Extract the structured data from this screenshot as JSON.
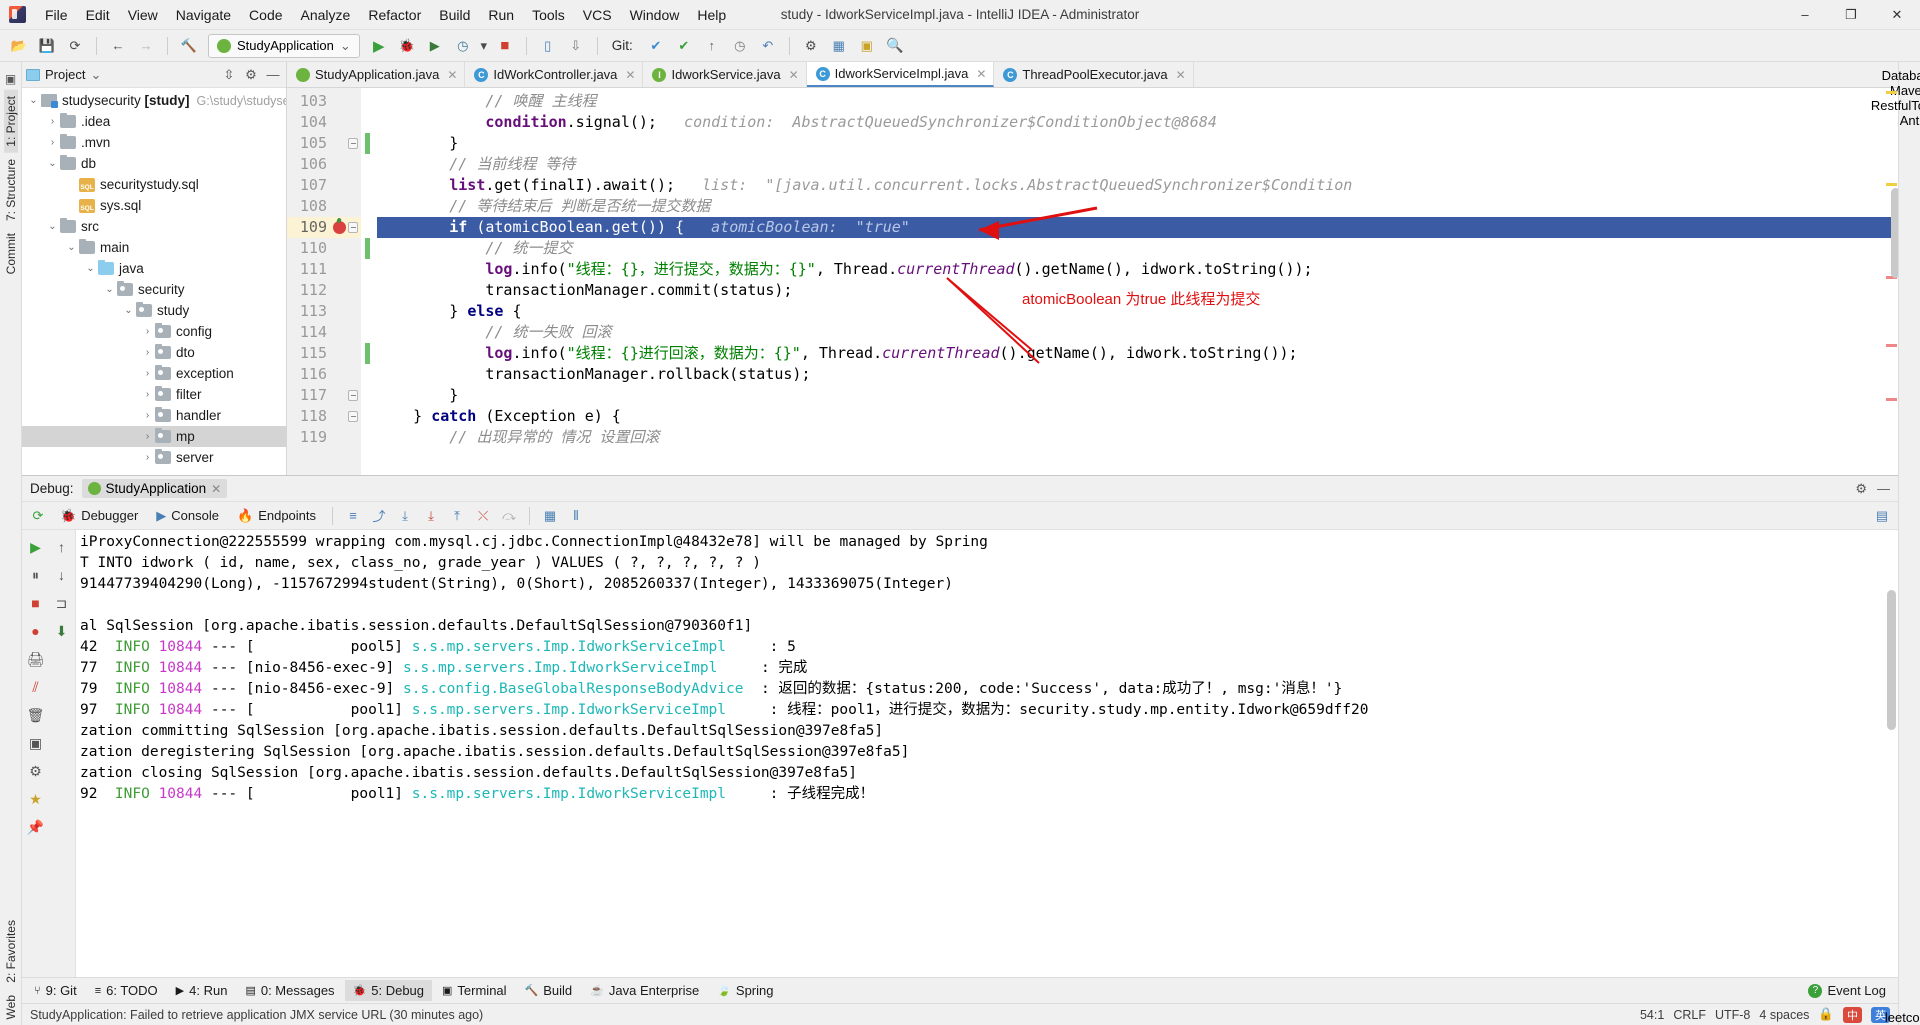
{
  "window": {
    "title": "study - IdworkServiceImpl.java - IntelliJ IDEA - Administrator",
    "minimize": "‒",
    "maximize": "❐",
    "close": "✕"
  },
  "menu": [
    {
      "label": "File"
    },
    {
      "label": "Edit"
    },
    {
      "label": "View"
    },
    {
      "label": "Navigate"
    },
    {
      "label": "Code"
    },
    {
      "label": "Analyze"
    },
    {
      "label": "Refactor"
    },
    {
      "label": "Build"
    },
    {
      "label": "Run"
    },
    {
      "label": "Tools"
    },
    {
      "label": "VCS"
    },
    {
      "label": "Window"
    },
    {
      "label": "Help"
    }
  ],
  "toolbar": {
    "open_icon": "📂",
    "save_icon": "💾",
    "sync_icon": "⟳",
    "back_icon": "←",
    "forward_icon": "→",
    "compile_icon": "🔨",
    "run_config": "StudyApplication",
    "run_config_caret": "⌄",
    "run_icon": "▶",
    "debug_icon": "🐞",
    "run_coverage_icon": "▶",
    "profile_icon": "◷",
    "profile_caret": "▾",
    "stop_icon": "■",
    "device_icon": "▯",
    "attach_icon": "⇩",
    "git_label": "Git:",
    "git_update_icon": "✔",
    "git_commit_icon": "✔",
    "git_push_icon": "↑",
    "git_history_icon": "◷",
    "undo_icon": "↶",
    "settings_icon": "⚙",
    "structure_icon": "▦",
    "bookmark_icon": "▣",
    "search_icon": "🔍"
  },
  "left_strip": {
    "project_label": "1: Project",
    "structure_label": "7: Structure",
    "commit_label": "Commit",
    "favorites_label": "2: Favorites",
    "web_label": "Web"
  },
  "right_strip": {
    "database_label": "Database",
    "maven_label": "Maven",
    "ant_label": "Ant",
    "restful_label": "RestfulToolkit",
    "leetcode_label": "leetcode"
  },
  "project_panel": {
    "title": "Project",
    "caret": "⌄",
    "collapse_icon": "⇳",
    "gear_icon": "⚙",
    "hide_icon": "—",
    "tree": [
      {
        "indent": 0,
        "twist": "⌄",
        "icon": "modroot",
        "label": "studysecurity",
        "bold": "[study]",
        "path": "G:\\study\\studysecurity",
        "selected": false
      },
      {
        "indent": 1,
        "twist": "›",
        "icon": "folder",
        "label": ".idea",
        "selected": false
      },
      {
        "indent": 1,
        "twist": "›",
        "icon": "folder",
        "label": ".mvn",
        "selected": false
      },
      {
        "indent": 1,
        "twist": "⌄",
        "icon": "folder",
        "label": "db",
        "selected": false
      },
      {
        "indent": 2,
        "twist": "",
        "icon": "sql",
        "label": "securitystudy.sql",
        "selected": false
      },
      {
        "indent": 2,
        "twist": "",
        "icon": "sql",
        "label": "sys.sql",
        "selected": false
      },
      {
        "indent": 1,
        "twist": "⌄",
        "icon": "folder",
        "label": "src",
        "selected": false
      },
      {
        "indent": 2,
        "twist": "⌄",
        "icon": "folder",
        "label": "main",
        "selected": false
      },
      {
        "indent": 3,
        "twist": "⌄",
        "icon": "folder-blue",
        "label": "java",
        "selected": false
      },
      {
        "indent": 4,
        "twist": "⌄",
        "icon": "folder-pkg",
        "label": "security",
        "selected": false
      },
      {
        "indent": 5,
        "twist": "⌄",
        "icon": "folder-pkg",
        "label": "study",
        "selected": false
      },
      {
        "indent": 6,
        "twist": "›",
        "icon": "folder-pkg",
        "label": "config",
        "selected": false
      },
      {
        "indent": 6,
        "twist": "›",
        "icon": "folder-pkg",
        "label": "dto",
        "selected": false
      },
      {
        "indent": 6,
        "twist": "›",
        "icon": "folder-pkg",
        "label": "exception",
        "selected": false
      },
      {
        "indent": 6,
        "twist": "›",
        "icon": "folder-pkg",
        "label": "filter",
        "selected": false
      },
      {
        "indent": 6,
        "twist": "›",
        "icon": "folder-pkg",
        "label": "handler",
        "selected": false
      },
      {
        "indent": 6,
        "twist": "›",
        "icon": "folder-pkg",
        "label": "mp",
        "selected": true
      },
      {
        "indent": 6,
        "twist": "›",
        "icon": "folder-pkg",
        "label": "server",
        "selected": false
      }
    ]
  },
  "editor_tabs": [
    {
      "label": "StudyApplication.java",
      "icon": "spring",
      "icon_char": "",
      "active": false,
      "close": "✕"
    },
    {
      "label": "IdWorkController.java",
      "icon": "c",
      "icon_char": "C",
      "active": false,
      "close": "✕"
    },
    {
      "label": "IdworkService.java",
      "icon": "i",
      "icon_char": "I",
      "active": false,
      "close": "✕"
    },
    {
      "label": "IdworkServiceImpl.java",
      "icon": "c",
      "icon_char": "C",
      "active": true,
      "close": "✕"
    },
    {
      "label": "ThreadPoolExecutor.java",
      "icon": "c",
      "icon_char": "C",
      "active": false,
      "close": "✕"
    }
  ],
  "editor": {
    "lines": [
      {
        "num": "103",
        "breakpoint": false,
        "fold": false,
        "current": false,
        "segments": [
          {
            "t": "            ",
            "c": "pl"
          },
          {
            "t": "// 唤醒 主线程",
            "c": "cmt"
          }
        ]
      },
      {
        "num": "104",
        "breakpoint": false,
        "fold": false,
        "current": false,
        "segments": [
          {
            "t": "            ",
            "c": "pl"
          },
          {
            "t": "condition",
            "c": "fld"
          },
          {
            "t": ".signal();",
            "c": "pl"
          },
          {
            "t": "   condition:  AbstractQueuedSynchronizer$ConditionObject@8684",
            "c": "hint"
          }
        ]
      },
      {
        "num": "105",
        "breakpoint": false,
        "fold": true,
        "current": false,
        "segments": [
          {
            "t": "        }",
            "c": "pl"
          }
        ]
      },
      {
        "num": "106",
        "breakpoint": false,
        "fold": false,
        "current": false,
        "segments": [
          {
            "t": "        ",
            "c": "pl"
          },
          {
            "t": "// 当前线程 等待",
            "c": "cmt"
          }
        ]
      },
      {
        "num": "107",
        "breakpoint": false,
        "fold": false,
        "current": false,
        "segments": [
          {
            "t": "        ",
            "c": "pl"
          },
          {
            "t": "list",
            "c": "fld"
          },
          {
            "t": ".get(finalI).await();",
            "c": "pl"
          },
          {
            "t": "   list:  \"[java.util.concurrent.locks.AbstractQueuedSynchronizer$Condition",
            "c": "hint"
          }
        ]
      },
      {
        "num": "108",
        "breakpoint": false,
        "fold": false,
        "current": false,
        "segments": [
          {
            "t": "        ",
            "c": "pl"
          },
          {
            "t": "// 等待结束后 判断是否统一提交数据",
            "c": "cmt"
          }
        ]
      },
      {
        "num": "109",
        "breakpoint": true,
        "fold": true,
        "current": true,
        "segments": [
          {
            "t": "        ",
            "c": "pl"
          },
          {
            "t": "if",
            "c": "kw"
          },
          {
            "t": " (atomicBoolean.get()) {",
            "c": "pl"
          },
          {
            "t": "   atomicBoolean:  \"true\"",
            "c": "hint"
          }
        ]
      },
      {
        "num": "110",
        "breakpoint": false,
        "fold": false,
        "current": false,
        "segments": [
          {
            "t": "            ",
            "c": "pl"
          },
          {
            "t": "// 统一提交",
            "c": "cmt"
          }
        ]
      },
      {
        "num": "111",
        "breakpoint": false,
        "fold": false,
        "current": false,
        "segments": [
          {
            "t": "            ",
            "c": "pl"
          },
          {
            "t": "log",
            "c": "fld"
          },
          {
            "t": ".info(",
            "c": "pl"
          },
          {
            "t": "\"线程：{}，进行提交，数据为：{}\"",
            "c": "str"
          },
          {
            "t": ", Thread.",
            "c": "pl"
          },
          {
            "t": "currentThread",
            "c": "sfld"
          },
          {
            "t": "().getName(), idwork.toString());",
            "c": "pl"
          }
        ]
      },
      {
        "num": "112",
        "breakpoint": false,
        "fold": false,
        "current": false,
        "segments": [
          {
            "t": "            transactionManager.commit(status);",
            "c": "pl"
          }
        ]
      },
      {
        "num": "113",
        "breakpoint": false,
        "fold": false,
        "current": false,
        "segments": [
          {
            "t": "        } ",
            "c": "pl"
          },
          {
            "t": "else",
            "c": "kw"
          },
          {
            "t": " {",
            "c": "pl"
          }
        ]
      },
      {
        "num": "114",
        "breakpoint": false,
        "fold": false,
        "current": false,
        "segments": [
          {
            "t": "            ",
            "c": "pl"
          },
          {
            "t": "// 统一失败 回滚",
            "c": "cmt"
          }
        ]
      },
      {
        "num": "115",
        "breakpoint": false,
        "fold": false,
        "current": false,
        "segments": [
          {
            "t": "            ",
            "c": "pl"
          },
          {
            "t": "log",
            "c": "fld"
          },
          {
            "t": ".info(",
            "c": "pl"
          },
          {
            "t": "\"线程：{}进行回滚，数据为：{}\"",
            "c": "str"
          },
          {
            "t": ", Thread.",
            "c": "pl"
          },
          {
            "t": "currentThread",
            "c": "sfld"
          },
          {
            "t": "().getName(), idwork.toString());",
            "c": "pl"
          }
        ]
      },
      {
        "num": "116",
        "breakpoint": false,
        "fold": false,
        "current": false,
        "segments": [
          {
            "t": "            transactionManager.rollback(status);",
            "c": "pl"
          }
        ]
      },
      {
        "num": "117",
        "breakpoint": false,
        "fold": true,
        "current": false,
        "segments": [
          {
            "t": "        }",
            "c": "pl"
          }
        ]
      },
      {
        "num": "118",
        "breakpoint": false,
        "fold": true,
        "current": false,
        "segments": [
          {
            "t": "    } ",
            "c": "pl"
          },
          {
            "t": "catch",
            "c": "kw"
          },
          {
            "t": " (Exception e) {",
            "c": "pl"
          }
        ]
      },
      {
        "num": "119",
        "breakpoint": false,
        "fold": false,
        "current": false,
        "segments": [
          {
            "t": "        ",
            "c": "pl"
          },
          {
            "t": "// 出现异常的 情况 设置回滚",
            "c": "cmt"
          }
        ]
      }
    ],
    "annotation": "atomicBoolean 为true 此线程为提交"
  },
  "debug": {
    "label": "Debug:",
    "run_config": "StudyApplication",
    "run_config_close": "✕",
    "gear_icon": "⚙",
    "hide_icon": "—",
    "restart_icon": "⟳",
    "tabs": [
      {
        "label": "Debugger",
        "icon": "🐞"
      },
      {
        "label": "Console",
        "icon": "▶"
      },
      {
        "label": "Endpoints",
        "icon": "🔥"
      }
    ],
    "tool_icons": [
      "≡",
      "⤴",
      "⤓",
      "⤓",
      "⤒",
      "⤬",
      "⤼",
      "▦",
      "⚟",
      "⫴"
    ],
    "side_icons": [
      "▶",
      "↑",
      "↓",
      "⏸",
      "⊐",
      "■",
      "⬇",
      "🔴",
      "🖨",
      "⫽",
      "🗑"
    ],
    "console_lines": [
      {
        "segments": [
          {
            "t": "iProxyConnection@222555599 wrapping com.mysql.cj.jdbc.ConnectionImpl@48432e78] will be managed by Spring",
            "c": "c-def"
          }
        ]
      },
      {
        "segments": [
          {
            "t": "T INTO idwork ( id, name, sex, class_no, grade_year ) VALUES ( ?, ?, ?, ?, ? )",
            "c": "c-def"
          }
        ]
      },
      {
        "segments": [
          {
            "t": "91447739404290(Long), -1157672994student(String), 0(Short), 2085260337(Integer), 1433369075(Integer)",
            "c": "c-def"
          }
        ]
      },
      {
        "segments": [
          {
            "t": "",
            "c": "c-def"
          }
        ]
      },
      {
        "segments": [
          {
            "t": "al SqlSession [org.apache.ibatis.session.defaults.DefaultSqlSession@790360f1]",
            "c": "c-def"
          }
        ]
      },
      {
        "segments": [
          {
            "t": "42  ",
            "c": "c-def"
          },
          {
            "t": "INFO",
            "c": "c-info"
          },
          {
            "t": " ",
            "c": "c-def"
          },
          {
            "t": "10844",
            "c": "c-pid"
          },
          {
            "t": " --- [           pool5] ",
            "c": "c-def"
          },
          {
            "t": "s.s.mp.servers.Imp.IdworkServiceImpl",
            "c": "c-cls"
          },
          {
            "t": "     : 5",
            "c": "c-def"
          }
        ]
      },
      {
        "segments": [
          {
            "t": "77  ",
            "c": "c-def"
          },
          {
            "t": "INFO",
            "c": "c-info"
          },
          {
            "t": " ",
            "c": "c-def"
          },
          {
            "t": "10844",
            "c": "c-pid"
          },
          {
            "t": " --- [nio-8456-exec-9] ",
            "c": "c-def"
          },
          {
            "t": "s.s.mp.servers.Imp.IdworkServiceImpl",
            "c": "c-cls"
          },
          {
            "t": "     : 完成",
            "c": "c-def"
          }
        ]
      },
      {
        "segments": [
          {
            "t": "79  ",
            "c": "c-def"
          },
          {
            "t": "INFO",
            "c": "c-info"
          },
          {
            "t": " ",
            "c": "c-def"
          },
          {
            "t": "10844",
            "c": "c-pid"
          },
          {
            "t": " --- [nio-8456-exec-9] ",
            "c": "c-def"
          },
          {
            "t": "s.s.config.BaseGlobalResponseBodyAdvice",
            "c": "c-cls"
          },
          {
            "t": "  : 返回的数据：{status:200, code:'Success', data:成功了！, msg:'消息！'}",
            "c": "c-def"
          }
        ]
      },
      {
        "segments": [
          {
            "t": "97  ",
            "c": "c-def"
          },
          {
            "t": "INFO",
            "c": "c-info"
          },
          {
            "t": " ",
            "c": "c-def"
          },
          {
            "t": "10844",
            "c": "c-pid"
          },
          {
            "t": " --- [           pool1] ",
            "c": "c-def"
          },
          {
            "t": "s.s.mp.servers.Imp.IdworkServiceImpl",
            "c": "c-cls"
          },
          {
            "t": "     : 线程：pool1，进行提交，数据为：security.study.mp.entity.Idwork@659dff20",
            "c": "c-def"
          }
        ]
      },
      {
        "segments": [
          {
            "t": "zation committing SqlSession [org.apache.ibatis.session.defaults.DefaultSqlSession@397e8fa5]",
            "c": "c-def"
          }
        ]
      },
      {
        "segments": [
          {
            "t": "zation deregistering SqlSession [org.apache.ibatis.session.defaults.DefaultSqlSession@397e8fa5]",
            "c": "c-def"
          }
        ]
      },
      {
        "segments": [
          {
            "t": "zation closing SqlSession [org.apache.ibatis.session.defaults.DefaultSqlSession@397e8fa5]",
            "c": "c-def"
          }
        ]
      },
      {
        "segments": [
          {
            "t": "92  ",
            "c": "c-def"
          },
          {
            "t": "INFO",
            "c": "c-info"
          },
          {
            "t": " ",
            "c": "c-def"
          },
          {
            "t": "10844",
            "c": "c-pid"
          },
          {
            "t": " --- [           pool1] ",
            "c": "c-def"
          },
          {
            "t": "s.s.mp.servers.Imp.IdworkServiceImpl",
            "c": "c-cls"
          },
          {
            "t": "     : 子线程完成！",
            "c": "c-def"
          }
        ]
      }
    ]
  },
  "bottom_bar": {
    "items": [
      {
        "label": "9: Git",
        "icon": "⑂",
        "active": false
      },
      {
        "label": "6: TODO",
        "icon": "≡",
        "active": false
      },
      {
        "label": "4: Run",
        "icon": "▶",
        "active": false
      },
      {
        "label": "0: Messages",
        "icon": "▤",
        "active": false
      },
      {
        "label": "5: Debug",
        "icon": "🐞",
        "active": true
      },
      {
        "label": "Terminal",
        "icon": "▣",
        "active": false
      },
      {
        "label": "Build",
        "icon": "🔨",
        "active": false
      },
      {
        "label": "Java Enterprise",
        "icon": "☕",
        "active": false
      },
      {
        "label": "Spring",
        "icon": "🍃",
        "active": false
      }
    ],
    "event_log": "Event Log",
    "event_log_icon": "?"
  },
  "status_bar": {
    "message": "StudyApplication: Failed to retrieve application JMX service URL (30 minutes ago)",
    "position": "54:1",
    "line_sep": "CRLF",
    "encoding": "UTF-8",
    "indent": "4 spaces",
    "branch": "",
    "ime_cn": "中",
    "ime_en": "英",
    "lock_icon": "🔒"
  }
}
